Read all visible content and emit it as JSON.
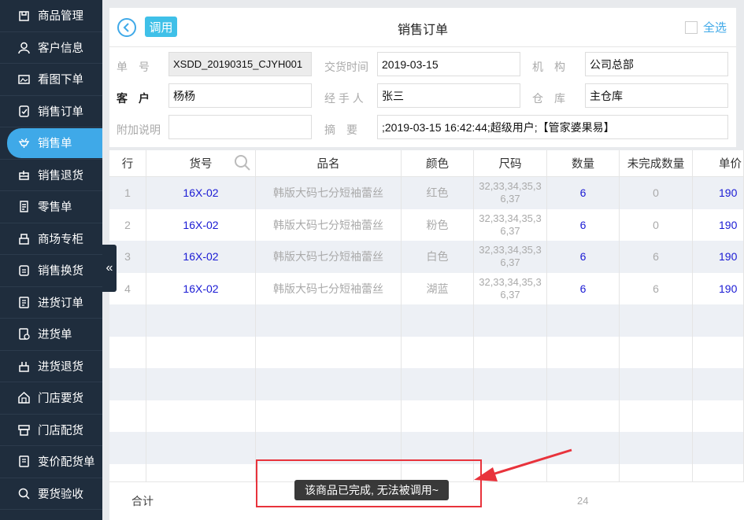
{
  "sidebar": {
    "items": [
      {
        "label": "商品管理",
        "icon": "box-icon",
        "active": false
      },
      {
        "label": "客户信息",
        "icon": "user-icon",
        "active": false
      },
      {
        "label": "看图下单",
        "icon": "image-icon",
        "active": false
      },
      {
        "label": "销售订单",
        "icon": "order-icon",
        "active": false
      },
      {
        "label": "销售单",
        "icon": "sales-icon",
        "active": true
      },
      {
        "label": "销售退货",
        "icon": "return-icon",
        "active": false
      },
      {
        "label": "零售单",
        "icon": "receipt-icon",
        "active": false
      },
      {
        "label": "商场专柜",
        "icon": "counter-icon",
        "active": false
      },
      {
        "label": "销售换货",
        "icon": "exchange-icon",
        "active": false
      },
      {
        "label": "进货订单",
        "icon": "purchase-order-icon",
        "active": false
      },
      {
        "label": "进货单",
        "icon": "purchase-icon",
        "active": false
      },
      {
        "label": "进货退货",
        "icon": "purchase-return-icon",
        "active": false
      },
      {
        "label": "门店要货",
        "icon": "store-request-icon",
        "active": false
      },
      {
        "label": "门店配货",
        "icon": "store-distribute-icon",
        "active": false
      },
      {
        "label": "变价配货单",
        "icon": "price-change-icon",
        "active": false
      },
      {
        "label": "要货验收",
        "icon": "inspect-icon",
        "active": false
      }
    ]
  },
  "header": {
    "call_label": "调用",
    "title": "销售订单",
    "select_all_label": "全选"
  },
  "form": {
    "order_no_label": "单　号",
    "order_no_value": "XSDD_20190315_CJYH001",
    "delivery_time_label": "交货时间",
    "delivery_time_value": "2019-03-15",
    "org_label": "机　构",
    "org_value": "公司总部",
    "customer_label": "客　户",
    "customer_value": "杨杨",
    "handler_label": "经 手 人",
    "handler_value": "张三",
    "warehouse_label": "仓　库",
    "warehouse_value": "主仓库",
    "extra_note_label": "附加说明",
    "extra_note_value": "",
    "summary_label": "摘　要",
    "summary_value": ";2019-03-15 16:42:44;超级用户;【管家婆果易】"
  },
  "table": {
    "headers": [
      "行",
      "货号",
      "品名",
      "颜色",
      "尺码",
      "数量",
      "未完成数量",
      "单价"
    ],
    "rows": [
      {
        "row": "1",
        "code": "16X-02",
        "name": "韩版大码七分短袖蕾丝",
        "color": "红色",
        "size": "32,33,34,35,36,37",
        "qty": "6",
        "pending": "0",
        "price": "190"
      },
      {
        "row": "2",
        "code": "16X-02",
        "name": "韩版大码七分短袖蕾丝",
        "color": "粉色",
        "size": "32,33,34,35,36,37",
        "qty": "6",
        "pending": "0",
        "price": "190"
      },
      {
        "row": "3",
        "code": "16X-02",
        "name": "韩版大码七分短袖蕾丝",
        "color": "白色",
        "size": "32,33,34,35,36,37",
        "qty": "6",
        "pending": "6",
        "price": "190"
      },
      {
        "row": "4",
        "code": "16X-02",
        "name": "韩版大码七分短袖蕾丝",
        "color": "湖蓝",
        "size": "32,33,34,35,36,37",
        "qty": "6",
        "pending": "6",
        "price": "190"
      }
    ]
  },
  "footer": {
    "total_label": "合计",
    "total_qty": "24"
  },
  "toast": {
    "message": "该商品已完成, 无法被调用~"
  },
  "colors": {
    "sidebar_bg": "#1f2d3d",
    "accent": "#3fa9e8",
    "annotation": "#e8333c",
    "link_blue": "#1a1ad4"
  }
}
